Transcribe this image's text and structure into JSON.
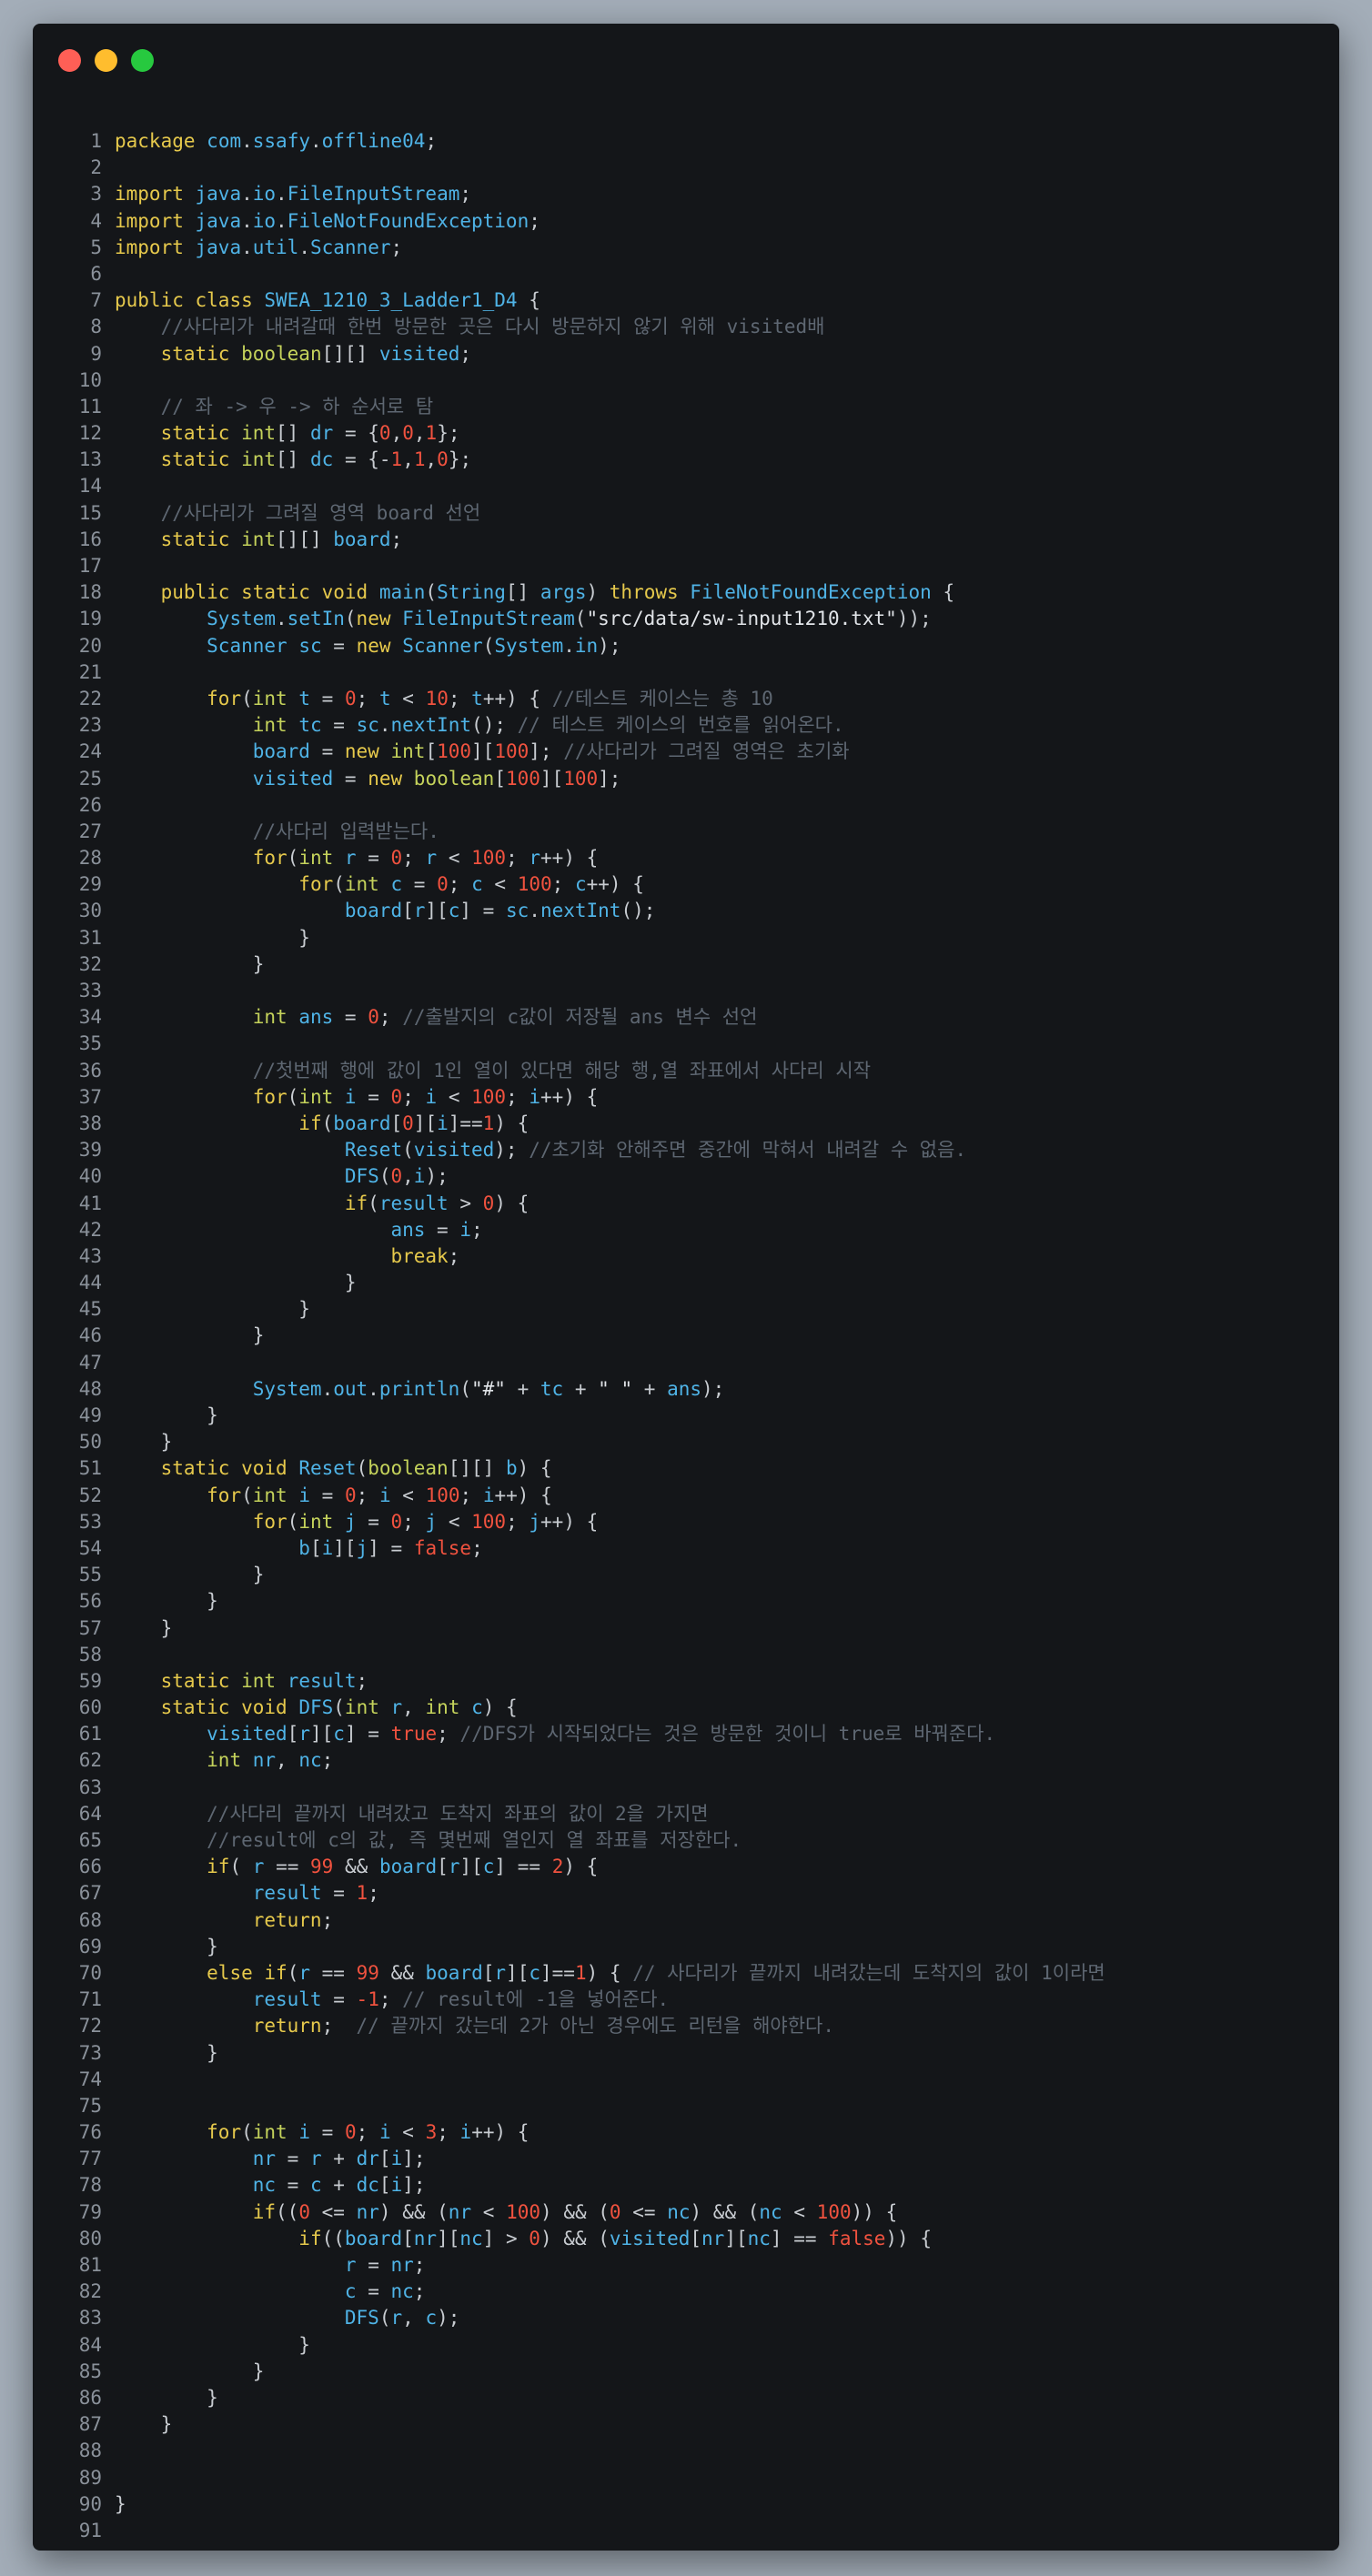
{
  "window": {
    "controls": [
      "close",
      "minimize",
      "zoom"
    ],
    "colors": {
      "close": "#ff5f56",
      "minimize": "#ffbd2e",
      "zoom": "#27c93f"
    }
  },
  "editor": {
    "language": "java",
    "colors": {
      "background": "#141619",
      "keyword": "#e6c94c",
      "type": "#c4d25b",
      "identifier": "#4fb3e6",
      "number": "#f0523f",
      "string": "#e1e4e8",
      "comment": "#5e6772",
      "line_number": "#8a919a"
    },
    "lines": [
      "package com.ssafy.offline04;",
      "",
      "import java.io.FileInputStream;",
      "import java.io.FileNotFoundException;",
      "import java.util.Scanner;",
      "",
      "public class SWEA_1210_3_Ladder1_D4 {",
      "    //사다리가 내려갈때 한번 방문한 곳은 다시 방문하지 않기 위해 visited배",
      "    static boolean[][] visited;",
      "",
      "    // 좌 -> 우 -> 하 순서로 탐",
      "    static int[] dr = {0,0,1};",
      "    static int[] dc = {-1,1,0};",
      "",
      "    //사다리가 그려질 영역 board 선언",
      "    static int[][] board;",
      "",
      "    public static void main(String[] args) throws FileNotFoundException {",
      "        System.setIn(new FileInputStream(\"src/data/sw-input1210.txt\"));",
      "        Scanner sc = new Scanner(System.in);",
      "",
      "        for(int t = 0; t < 10; t++) { //테스트 케이스는 총 10",
      "            int tc = sc.nextInt(); // 테스트 케이스의 번호를 읽어온다.",
      "            board = new int[100][100]; //사다리가 그려질 영역은 초기화",
      "            visited = new boolean[100][100];",
      "",
      "            //사다리 입력받는다.",
      "            for(int r = 0; r < 100; r++) {",
      "                for(int c = 0; c < 100; c++) {",
      "                    board[r][c] = sc.nextInt();",
      "                }",
      "            }",
      "",
      "            int ans = 0; //출발지의 c값이 저장될 ans 변수 선언",
      "",
      "            //첫번째 행에 값이 1인 열이 있다면 해당 행,열 좌표에서 사다리 시작",
      "            for(int i = 0; i < 100; i++) {",
      "                if(board[0][i]==1) {",
      "                    Reset(visited); //초기화 안해주면 중간에 막혀서 내려갈 수 없음.",
      "                    DFS(0,i);",
      "                    if(result > 0) {",
      "                        ans = i;",
      "                        break;",
      "                    }",
      "                }",
      "            }",
      "",
      "            System.out.println(\"#\" + tc + \" \" + ans);",
      "        }",
      "    }",
      "    static void Reset(boolean[][] b) {",
      "        for(int i = 0; i < 100; i++) {",
      "            for(int j = 0; j < 100; j++) {",
      "                b[i][j] = false;",
      "            }",
      "        }",
      "    }",
      "",
      "    static int result;",
      "    static void DFS(int r, int c) {",
      "        visited[r][c] = true; //DFS가 시작되었다는 것은 방문한 것이니 true로 바꿔준다.",
      "        int nr, nc;",
      "",
      "        //사다리 끝까지 내려갔고 도착지 좌표의 값이 2을 가지면",
      "        //result에 c의 값, 즉 몇번째 열인지 열 좌표를 저장한다.",
      "        if( r == 99 && board[r][c] == 2) {",
      "            result = 1;",
      "            return;",
      "        }",
      "        else if(r == 99 && board[r][c]==1) { // 사다리가 끝까지 내려갔는데 도착지의 값이 1이라면",
      "            result = -1; // result에 -1을 넣어준다.",
      "            return;  // 끝까지 갔는데 2가 아닌 경우에도 리턴을 해야한다.",
      "        }",
      "",
      "",
      "        for(int i = 0; i < 3; i++) {",
      "            nr = r + dr[i];",
      "            nc = c + dc[i];",
      "            if((0 <= nr) && (nr < 100) && (0 <= nc) && (nc < 100)) {",
      "                if((board[nr][nc] > 0) && (visited[nr][nc] == false)) {",
      "                    r = nr;",
      "                    c = nc;",
      "                    DFS(r, c);",
      "                }",
      "            }",
      "        }",
      "    }",
      "",
      "",
      "}",
      ""
    ]
  }
}
